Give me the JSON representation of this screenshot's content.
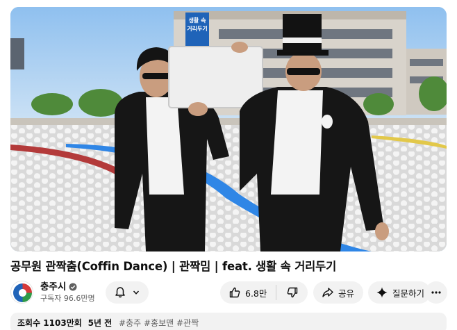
{
  "video": {
    "title": "공무원 관짝춤(Coffin Dance) | 관짝밈 | feat. 생활 속 거리두기",
    "scene_sign": [
      "생활 속",
      "거리두기"
    ]
  },
  "channel": {
    "name": "충주시",
    "subscribers": "구독자 96.6만명",
    "verified_icon": "verified-check-icon"
  },
  "actions": {
    "notify_icon": "bell-icon",
    "likes": "6.8만",
    "share_label": "공유",
    "ask_label": "질문하기",
    "more_icon": "more-horizontal-icon"
  },
  "description": {
    "views": "조회수 1103만회",
    "age": "5년 전",
    "tags": "#충주 #홍보맨 #관짝"
  },
  "colors": {
    "pill_bg": "#f2f2f2",
    "secondary_text": "#606060"
  }
}
